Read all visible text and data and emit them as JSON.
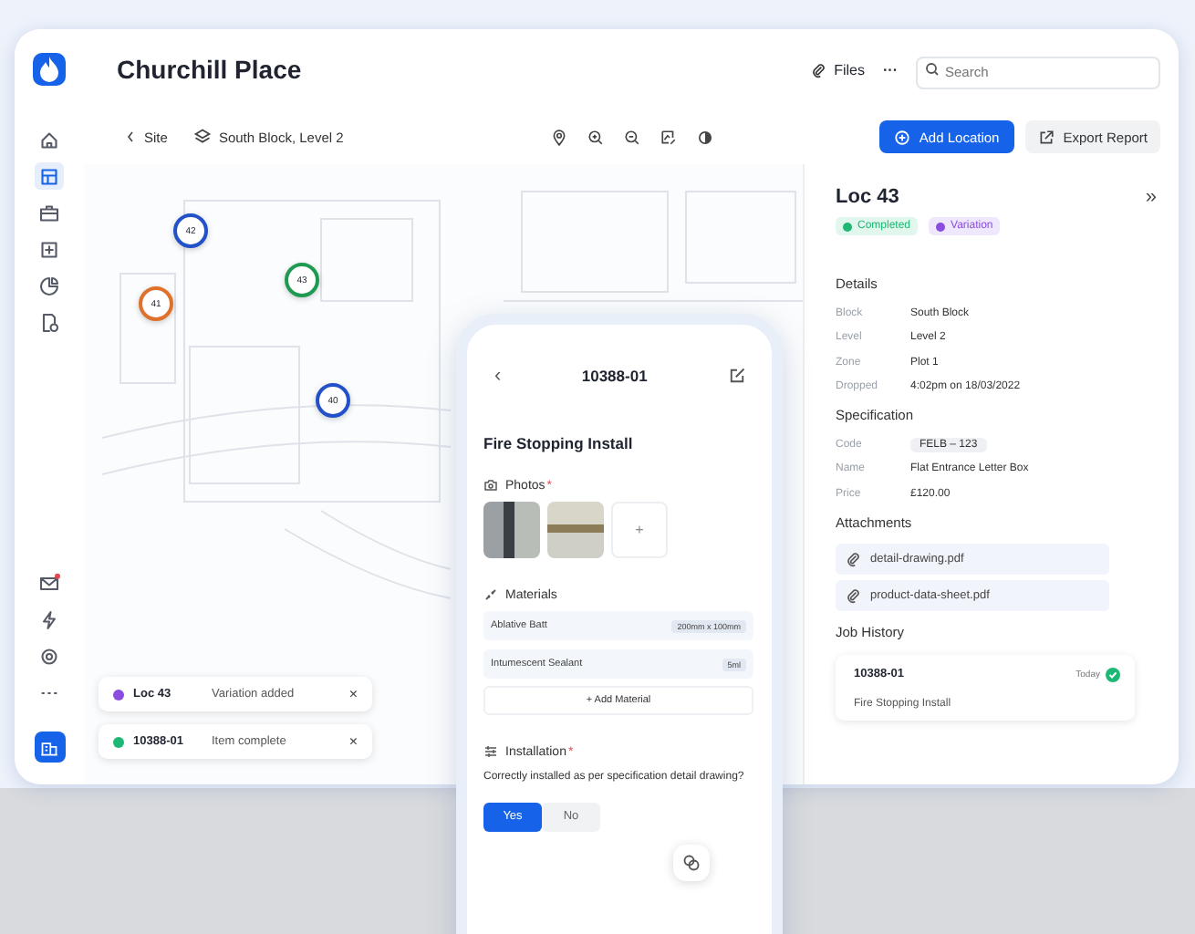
{
  "app": {
    "title": "Churchill Place",
    "files": "Files",
    "more": "···",
    "search": {
      "placeholder": "Search"
    }
  },
  "sidebar": {
    "top": [
      {
        "kind": "home",
        "selected": false
      },
      {
        "kind": "plans",
        "selected": true
      },
      {
        "kind": "briefcase",
        "selected": false
      },
      {
        "kind": "add",
        "selected": false
      },
      {
        "kind": "chart",
        "selected": false
      },
      {
        "kind": "report",
        "selected": false
      }
    ],
    "bottom": [
      {
        "kind": "mail",
        "alert": true
      },
      {
        "kind": "bolt",
        "alert": false
      },
      {
        "kind": "settings",
        "alert": false
      },
      {
        "kind": "more",
        "alert": false
      }
    ]
  },
  "toolbar": {
    "back": "Site",
    "location": "South Block, Level 2",
    "add_location": "Add Location",
    "export": "Export Report"
  },
  "map": {
    "pins": [
      {
        "label": "42",
        "color": "#2352c8"
      },
      {
        "label": "43",
        "color": "#1e9a52"
      },
      {
        "label": "41",
        "color": "#e0712c"
      },
      {
        "label": "40",
        "color": "#2352c8"
      }
    ]
  },
  "toasts": [
    {
      "title": "Loc 43",
      "message": "Variation added",
      "color": "#8a4de0",
      "close": "×"
    },
    {
      "title": "10388-01",
      "message": "Item complete",
      "color": "#1db873",
      "close": "×"
    }
  ],
  "panel": {
    "title": "Loc 43",
    "collapse": "»",
    "tags": [
      {
        "label": "Completed",
        "color": "#1db873"
      },
      {
        "label": "Variation",
        "color": "#8a4de0"
      }
    ],
    "details": {
      "title": "Details",
      "rows": [
        {
          "label": "Block",
          "value": "South Block"
        },
        {
          "label": "Level",
          "value": "Level 2"
        },
        {
          "label": "Zone",
          "value": "Plot 1"
        },
        {
          "label": "Dropped",
          "value": "4:02pm on 18/03/2022"
        }
      ]
    },
    "specification": {
      "title": "Specification",
      "rows": [
        {
          "label": "Code",
          "value": "FELB – 123",
          "kind": "chip"
        },
        {
          "label": "Name",
          "value": "Flat Entrance Letter Box",
          "kind": "text"
        },
        {
          "label": "Price",
          "value": "£120.00",
          "kind": "text"
        }
      ]
    },
    "attachments": {
      "title": "Attachments",
      "files": [
        "detail-drawing.pdf",
        "product-data-sheet.pdf"
      ]
    },
    "job_history": {
      "title": "Job History",
      "entries": [
        {
          "id": "10388-01",
          "when": "Today",
          "name": "Fire Stopping Install"
        }
      ]
    }
  },
  "phone": {
    "back": "‹",
    "id": "10388-01",
    "title": "Fire Stopping Install",
    "photos": {
      "label": "Photos",
      "required": "*",
      "add": "+"
    },
    "materials": {
      "label": "Materials",
      "items": [
        {
          "name": "Ablative Batt",
          "amount": "200mm x 100mm"
        },
        {
          "name": "Intumescent Sealant",
          "amount": "5ml"
        }
      ],
      "add": "+ Add Material"
    },
    "installation": {
      "label": "Installation",
      "required": "*",
      "question": "Correctly installed as per specification detail drawing?",
      "options": [
        {
          "label": "Yes",
          "selected": true
        },
        {
          "label": "No",
          "selected": false
        }
      ]
    }
  }
}
